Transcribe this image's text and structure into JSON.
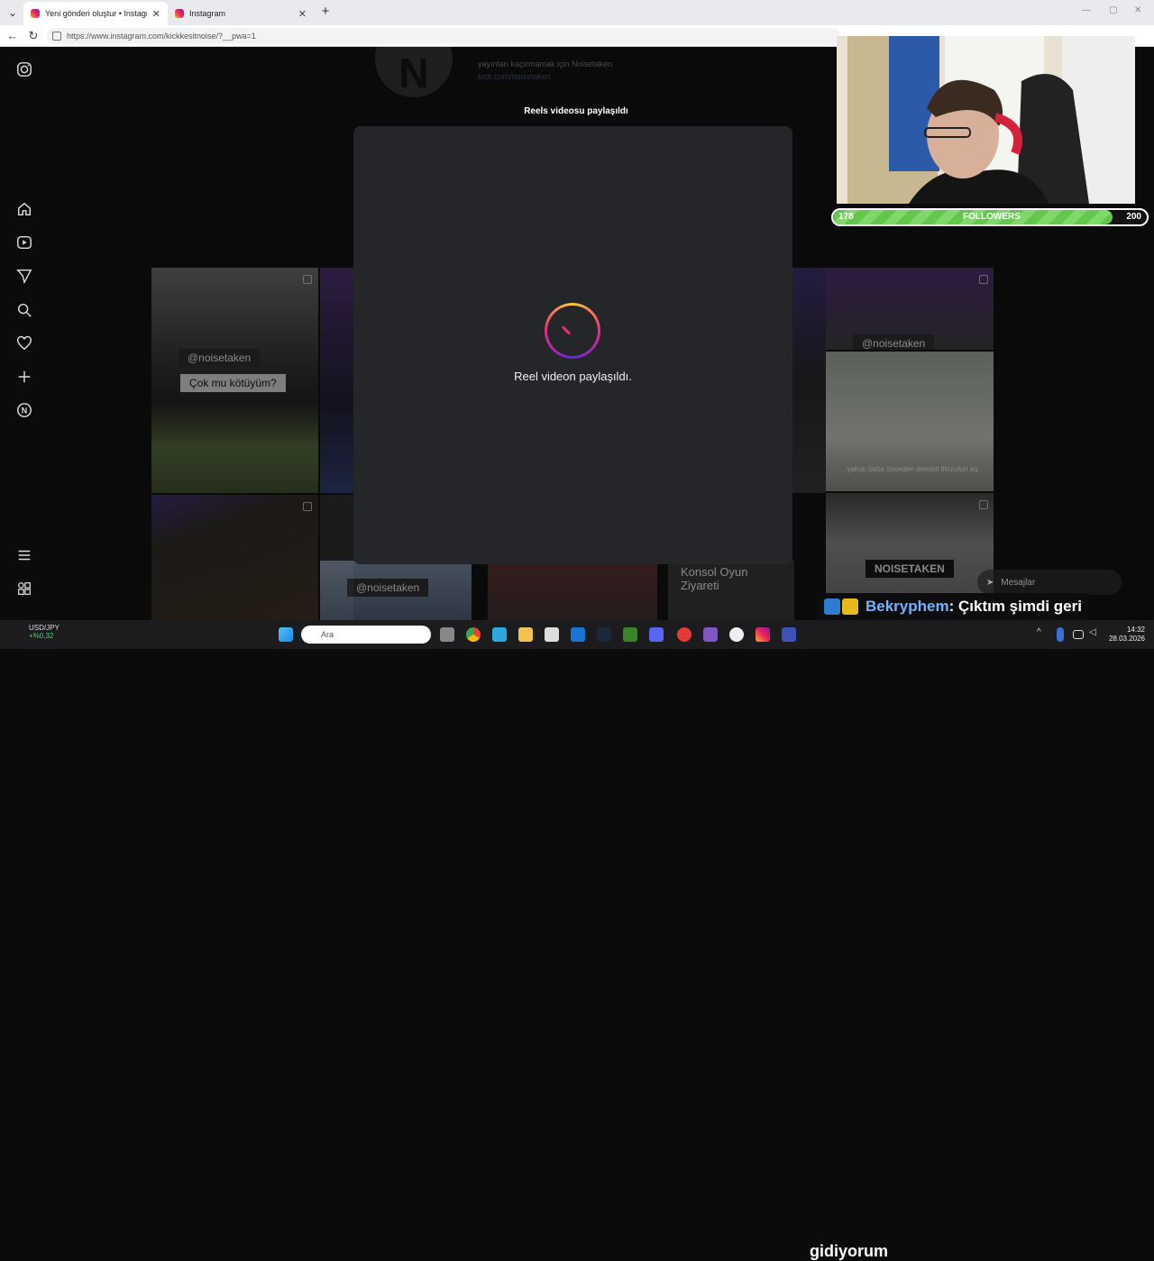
{
  "browser": {
    "tabs": [
      {
        "title": "Yeni gönderi oluştur • Instagram",
        "active": true
      },
      {
        "title": "Instagram",
        "active": false
      }
    ],
    "url": "https://www.instagram.com/kickkesitnoise/?__pwa=1"
  },
  "profile": {
    "bio_line": "yayınları kaçırmamak için Noisetaken",
    "link": "kick.com/noisetaken",
    "avatar_letter": "N"
  },
  "grid": {
    "tag_noisetaken": "@noisetaken",
    "tag_question": "Çok mu kötüyüm?",
    "tag_consol": "Konsol Oyun Ziyareti",
    "tag_brand": "NOISETAKEN",
    "caption_small": "yakup baba önceden demişti filozofun aq"
  },
  "modal": {
    "title": "Reels videosu paylaşıldı",
    "message": "Reel videon paylaşıldı."
  },
  "messages": {
    "label": "Mesajlar"
  },
  "overlay": {
    "followers": {
      "current": "178",
      "label": "FOLLOWERS",
      "goal": "200",
      "progress": 0.89
    },
    "chat": {
      "user": "Bekryphem",
      "text": ": Çıktım şimdi geri",
      "text2": "gidiyorum"
    }
  },
  "taskbar": {
    "ticker_name": "USD/JPY",
    "ticker_change": "+%0,32",
    "search_placeholder": "Ara",
    "time": "14:32",
    "date": "28.03.2026"
  }
}
